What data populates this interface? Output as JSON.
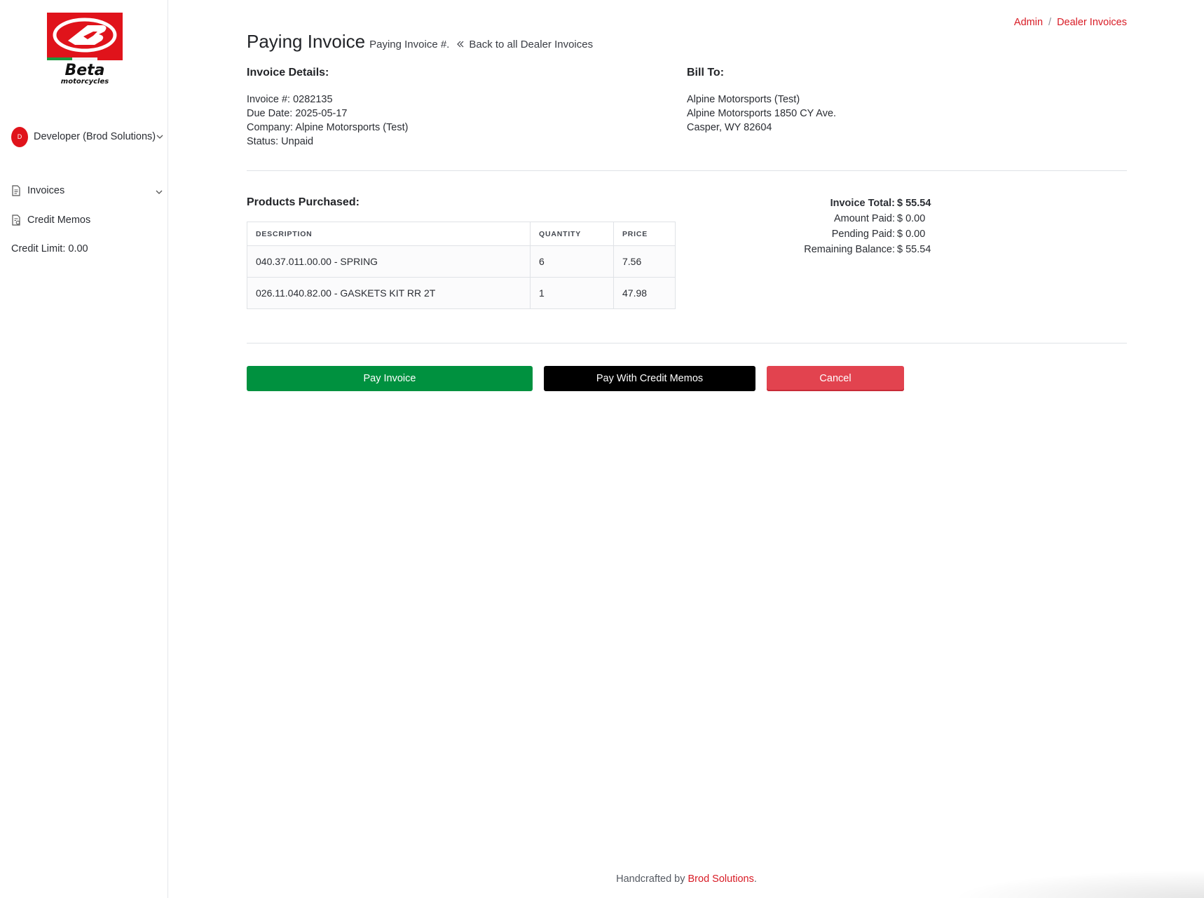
{
  "sidebar": {
    "logo_text": "Beta motorcycles",
    "user": {
      "initial": "D",
      "name": "Developer (Brod Solutions)"
    },
    "nav": [
      {
        "label": "Invoices",
        "icon": "document-icon"
      },
      {
        "label": "Credit Memos",
        "icon": "document-dollar-icon"
      }
    ],
    "credit_limit": "Credit Limit: 0.00"
  },
  "breadcrumb": {
    "items": [
      "Admin",
      "Dealer Invoices"
    ],
    "separator": "/"
  },
  "header": {
    "title": "Paying Invoice",
    "subtitle": "Paying Invoice #.",
    "back_link": "Back to all Dealer Invoices"
  },
  "invoice_details": {
    "heading": "Invoice Details:",
    "lines": [
      "Invoice #: 0282135",
      "Due Date: 2025-05-17",
      "Company: Alpine Motorsports (Test)",
      "Status: Unpaid"
    ]
  },
  "bill_to": {
    "heading": "Bill To:",
    "lines": [
      "Alpine Motorsports (Test)",
      "Alpine Motorsports 1850 CY Ave.",
      "Casper, WY 82604"
    ]
  },
  "products": {
    "heading": "Products Purchased:",
    "columns": [
      "DESCRIPTION",
      "QUANTITY",
      "PRICE"
    ],
    "rows": [
      [
        "040.37.011.00.00 - SPRING",
        "6",
        "7.56"
      ],
      [
        "026.11.040.82.00 - GASKETS KIT RR 2T",
        "1",
        "47.98"
      ]
    ]
  },
  "totals": [
    {
      "label": "Invoice Total:",
      "value": "$ 55.54"
    },
    {
      "label": "Amount Paid:",
      "value": "$ 0.00"
    },
    {
      "label": "Pending Paid:",
      "value": "$ 0.00"
    },
    {
      "label": "Remaining Balance:",
      "value": "$ 55.54"
    }
  ],
  "actions": {
    "pay": "Pay Invoice",
    "pay_credit": "Pay With Credit Memos",
    "cancel": "Cancel"
  },
  "footer": {
    "prefix": "Handcrafted by ",
    "link": "Brod Solutions",
    "suffix": "."
  },
  "colors": {
    "brand_red": "#d81a24",
    "pay_green": "#00913f",
    "cancel_red": "#e2434f",
    "credit_black": "#000000"
  }
}
